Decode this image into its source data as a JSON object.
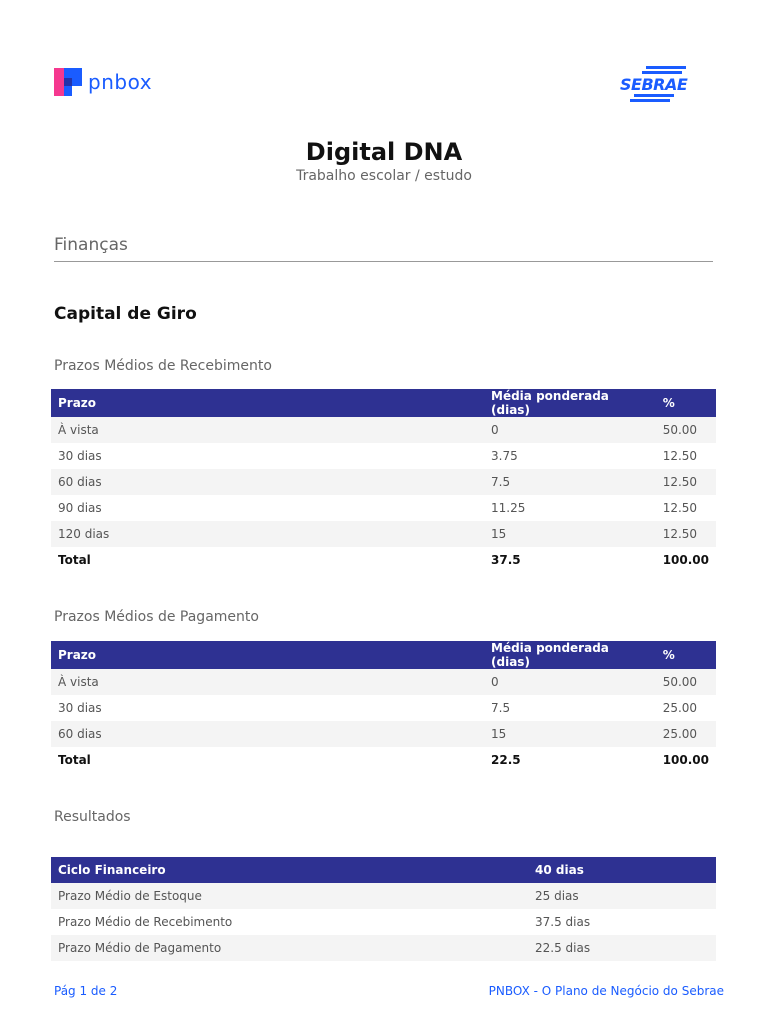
{
  "header": {
    "logo_text": "pnbox",
    "partner_logo": "SEBRAE"
  },
  "title": "Digital DNA",
  "subtitle": "Trabalho escolar / estudo",
  "section": "Finanças",
  "heading": "Capital de Giro",
  "recebimento": {
    "title": "Prazos Médios de Recebimento",
    "columns": [
      "Prazo",
      "Média ponderada (dias)",
      "%"
    ],
    "rows": [
      [
        "À vista",
        "0",
        "50.00"
      ],
      [
        "30 dias",
        "3.75",
        "12.50"
      ],
      [
        "60 dias",
        "7.5",
        "12.50"
      ],
      [
        "90 dias",
        "11.25",
        "12.50"
      ],
      [
        "120 dias",
        "15",
        "12.50"
      ]
    ],
    "total": [
      "Total",
      "37.5",
      "100.00"
    ]
  },
  "pagamento": {
    "title": "Prazos Médios de Pagamento",
    "columns": [
      "Prazo",
      "Média ponderada (dias)",
      "%"
    ],
    "rows": [
      [
        "À vista",
        "0",
        "50.00"
      ],
      [
        "30 dias",
        "7.5",
        "25.00"
      ],
      [
        "60 dias",
        "15",
        "25.00"
      ]
    ],
    "total": [
      "Total",
      "22.5",
      "100.00"
    ]
  },
  "resultados": {
    "title": "Resultados",
    "columns": [
      "Ciclo Financeiro",
      "40 dias"
    ],
    "rows": [
      [
        "Prazo Médio de Estoque",
        "25 dias"
      ],
      [
        "Prazo Médio de Recebimento",
        "37.5 dias"
      ],
      [
        "Prazo Médio de Pagamento",
        "22.5 dias"
      ]
    ]
  },
  "footer": {
    "page": "Pág 1 de 2",
    "brand": "PNBOX - O Plano de Negócio do Sebrae"
  }
}
